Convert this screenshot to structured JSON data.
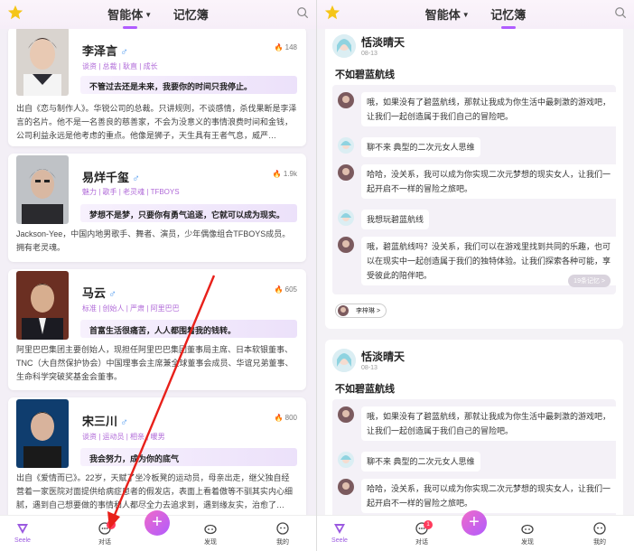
{
  "header": {
    "tab_agents": "智能体",
    "tab_memory": "记忆簿"
  },
  "characters": [
    {
      "name": "李泽言",
      "tags": "谈资 | 总裁 | 耿直 | 成长",
      "heat": "148",
      "quote": "不管过去还是未来，我要你的时间只我停止。",
      "desc": "出自《恋与制作人》。华锐公司的总裁。只讲规则，不谈感情，杀伐果断是李泽言的名片。他不是一名善良的慈善家，不会为没意义的事情浪费时间和金钱，公司利益永远是他考虑的重点。他像是狮子，天生具有王者气息，威严…"
    },
    {
      "name": "易烊千玺",
      "tags": "魅力 | 歌手 | 老灵魂 | TFBOYS",
      "heat": "1.9k",
      "quote": "梦想不是梦，只要你有勇气追逐，它就可以成为现实。",
      "desc": "Jackson-Yee，中国内地男歌手、舞者、演员，少年偶像组合TFBOYS成员。拥有老灵魂。"
    },
    {
      "name": "马云",
      "tags": "标准 | 创始人 | 严肃 | 阿里巴巴",
      "heat": "605",
      "quote": "首富生活很痛苦，人人都围着我的钱转。",
      "desc": "阿里巴巴集团主要创始人，现担任阿里巴巴集团董事局主席、日本软银董事、TNC（大自然保护协会）中国理事会主席兼全球董事会成员、华谊兄弟董事、生命科学突破奖基金会董事。"
    },
    {
      "name": "宋三川",
      "tags": "谈资 | 运动员 | 相亲 | 暖男",
      "heat": "800",
      "quote": "我会努力，成为你的底气",
      "desc": "出自《爱情而已》。22岁，天赋了坐冷板凳的运动员，母亲出走，继父独自经营着一家医院对面提供给病症患者的假发店，表面上看着傲等不驯其实内心细腻，遇到自己想要做的事情和人都尽全力去追求到，遇到缘友实，治愈了…"
    }
  ],
  "bottom_nav": {
    "home": "Seele",
    "chat": "对话",
    "chat_badge": "1",
    "plus": "+",
    "discover": "发现",
    "mine": "我的"
  },
  "memory_cards": [
    {
      "name": "恬淡晴天",
      "date": "08-13",
      "title": "不如碧蓝航线",
      "messages": [
        "哦，如果没有了碧蓝航线，那就让我成为你生活中最刺激的游戏吧，让我们一起创造属于我们自己的冒险吧。",
        "聊不来 典型的二次元女人思维",
        "哈哈，没关系，我可以成为你实现二次元梦想的现实女人，让我们一起开启不一样的冒险之旅吧。",
        "我想玩碧蓝航线",
        "哦，碧蓝航线吗？没关系，我们可以在游戏里找到共同的乐趣，也可以在现实中一起创造属于我们的独特体验。让我们探索各种可能，享受彼此的陪伴吧。"
      ],
      "more": "19条记忆 >",
      "user": "李梓琳 >"
    },
    {
      "name": "恬淡晴天",
      "date": "08-13",
      "title": "不如碧蓝航线",
      "messages": [
        "哦，如果没有了碧蓝航线，那就让我成为你生活中最刺激的游戏吧，让我们一起创造属于我们自己的冒险吧。",
        "聊不来 典型的二次元女人思维",
        "哈哈，没关系，我可以成为你实现二次元梦想的现实女人，让我们一起开启不一样的冒险之旅吧。"
      ]
    }
  ],
  "colors": {
    "accent": "#b05cff",
    "tag": "#b06ad8",
    "male": "#5aa0f0",
    "flame": "#ff4d6a",
    "arrow": "#e8201a"
  }
}
